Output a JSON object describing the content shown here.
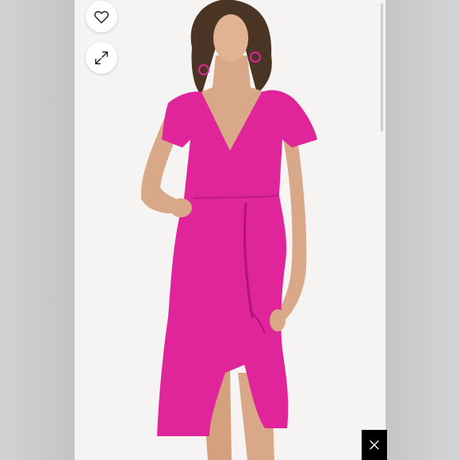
{
  "viewer": {
    "background": "#f6f4f2",
    "dress_color": "#e0249a",
    "like_icon": "heart-icon",
    "expand_icon": "expand-arrows-icon",
    "close_icon": "close-icon",
    "like_label": "",
    "expand_label": "",
    "close_label": ""
  }
}
